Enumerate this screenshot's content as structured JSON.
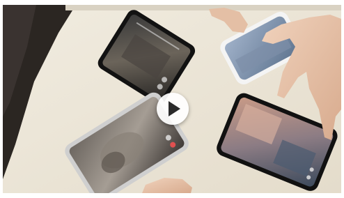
{
  "video": {
    "play_label": "Play video"
  },
  "colors": {
    "table": "#ece6d8",
    "background_left": "#2b2622",
    "phone_body": "#121212",
    "skin": "#e6c2a8",
    "play_icon": "#2a2a2a"
  },
  "icons": [
    "play-icon"
  ]
}
